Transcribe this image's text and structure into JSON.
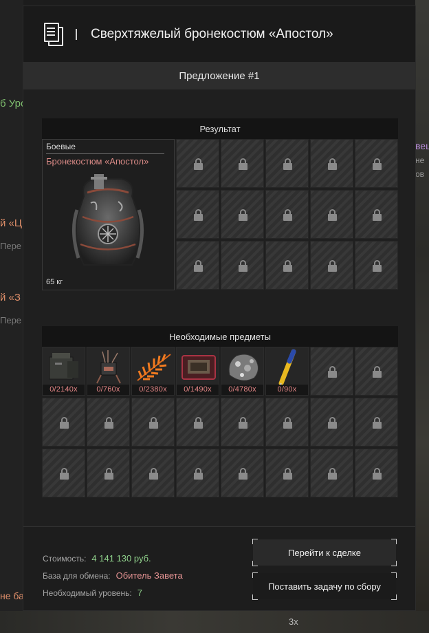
{
  "background": {
    "left_fragments": [
      "б Уро",
      "й «Ц",
      "Пере",
      "й «З",
      "Пере",
      "не ба"
    ],
    "right_fragments": [
      "вещ",
      "не",
      "ов"
    ],
    "bottom_fragment": "3x"
  },
  "dialog": {
    "icon": "document-icon",
    "title": "Сверхтяжелый бронекостюм «Апостол»",
    "offer_label": "Предложение #1"
  },
  "result": {
    "header": "Результат",
    "item": {
      "category": "Боевые",
      "name": "Бронекостюм «Апостол»",
      "weight": "65 кг",
      "icon": "armor-suit-icon"
    },
    "locked_slots": 15
  },
  "required": {
    "header": "Необходимые предметы",
    "items": [
      {
        "icon": "ammo-box-icon",
        "qty": "0/2140x"
      },
      {
        "icon": "electronic-component-icon",
        "qty": "0/760x"
      },
      {
        "icon": "orange-fern-icon",
        "qty": "0/2380x"
      },
      {
        "icon": "red-case-icon",
        "qty": "0/1490x"
      },
      {
        "icon": "metal-scrap-icon",
        "qty": "0/4780x"
      },
      {
        "icon": "syringe-icon",
        "qty": "0/90x"
      }
    ],
    "locked_slots": 18
  },
  "footer": {
    "cost_label": "Стоимость:",
    "cost_value": "4 141 130 руб.",
    "base_label": "База для обмена:",
    "base_value": "Обитель Завета",
    "level_label": "Необходимый уровень:",
    "level_value": "7",
    "goto_button": "Перейти к сделке",
    "task_button": "Поставить задачу по сбору"
  },
  "colors": {
    "price_green": "#8fd08b",
    "name_pink": "#d98a86",
    "qty_red": "#e38585"
  }
}
